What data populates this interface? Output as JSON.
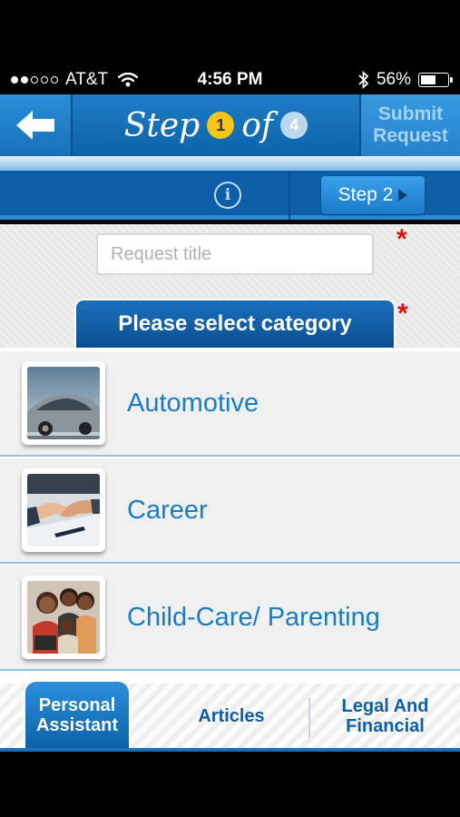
{
  "status_bar": {
    "carrier": "AT&T",
    "signal_bars_filled": 2,
    "signal_bars_total": 5,
    "time": "4:56 PM",
    "battery": "56%",
    "battery_level": 0.56
  },
  "header": {
    "step_word": "Step",
    "current_step": "1",
    "of_word": "of",
    "total_steps": "4",
    "submit_line1": "Submit",
    "submit_line2": "Request"
  },
  "subbar": {
    "info_glyph": "i",
    "next_step_label": "Step 2"
  },
  "form": {
    "title_placeholder": "Request title",
    "title_value": "",
    "required_mark": "*",
    "category_heading": "Please select category"
  },
  "categories": [
    {
      "label": "Automotive",
      "icon": "car-photo"
    },
    {
      "label": "Career",
      "icon": "handshake-photo"
    },
    {
      "label": "Child-Care/ Parenting",
      "icon": "family-photo"
    }
  ],
  "tabs": [
    {
      "line1": "Personal",
      "line2": "Assistant",
      "active": true
    },
    {
      "line1": "Articles",
      "line2": "",
      "active": false
    },
    {
      "line1": "Legal And",
      "line2": "Financial",
      "active": false
    }
  ],
  "colors": {
    "brand_blue": "#0d5ea6",
    "link_blue": "#1a7cc4",
    "required_red": "#e01010",
    "step_badge": "#f5c518"
  }
}
